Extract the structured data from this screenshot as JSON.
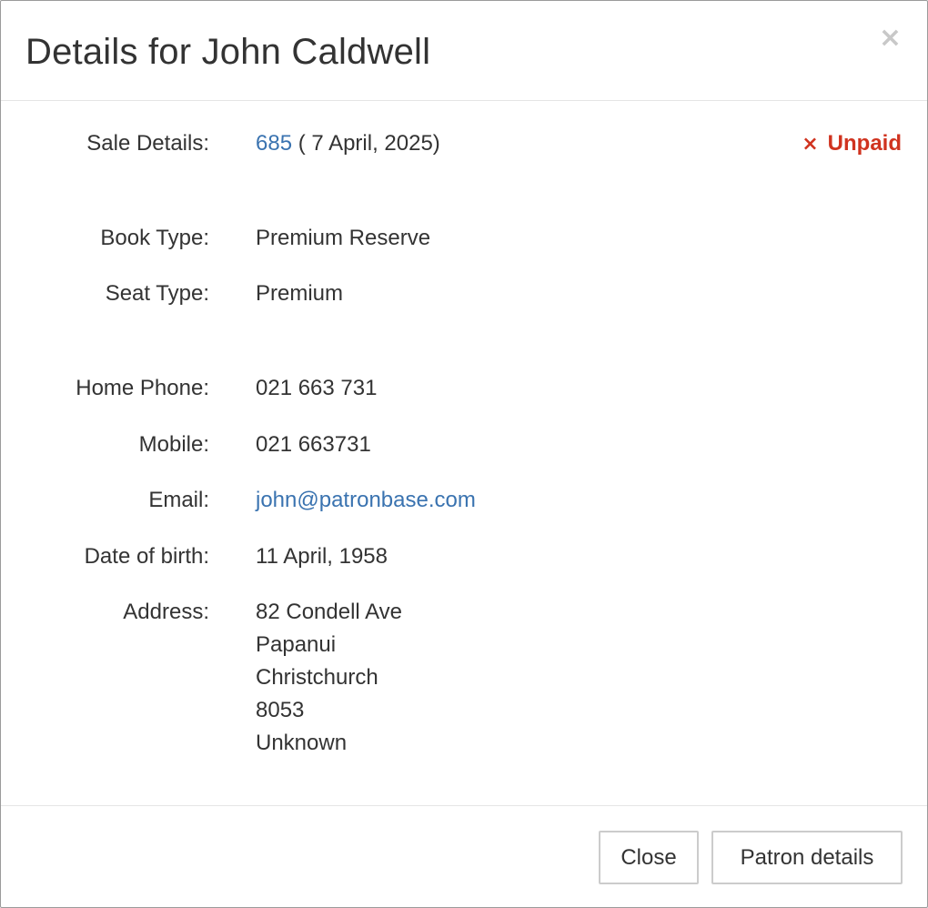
{
  "modal": {
    "title": "Details for John Caldwell",
    "close_icon": "×"
  },
  "sale": {
    "label": "Sale Details:",
    "number": "685",
    "date": " ( 7 April, 2025)",
    "status_icon": "×",
    "status": "Unpaid",
    "status_color": "#d0331f"
  },
  "booking": {
    "book_type_label": "Book Type:",
    "book_type": "Premium Reserve",
    "seat_type_label": "Seat Type:",
    "seat_type": "Premium"
  },
  "contact": {
    "home_phone_label": "Home Phone:",
    "home_phone": "021 663 731",
    "mobile_label": "Mobile:",
    "mobile": "021 663731",
    "email_label": "Email:",
    "email": "john@patronbase.com",
    "dob_label": "Date of birth:",
    "dob": "11 April, 1958",
    "address_label": "Address:",
    "address_lines": [
      "82 Condell Ave",
      "Papanui",
      "Christchurch",
      "8053",
      "Unknown"
    ]
  },
  "footer": {
    "close_label": "Close",
    "patron_details_label": "Patron details"
  },
  "colors": {
    "link": "#3a73b0",
    "text": "#333333",
    "border": "#e5e5e5"
  }
}
